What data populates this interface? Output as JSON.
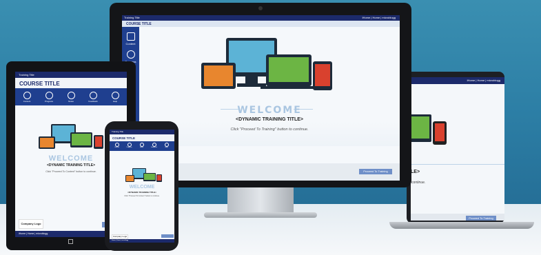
{
  "monitor": {
    "top_bar": {
      "title": "Training Title",
      "links": "iHome | Home  |  microblogg"
    },
    "course_title": "COURSE TITLE",
    "sidebar": [
      {
        "label": "Content",
        "icon": "book-icon"
      },
      {
        "label": "Progress",
        "icon": "check-icon"
      }
    ],
    "welcome": "WELCOME",
    "training_title": "<DYNAMIC TRAINING TITLE>",
    "instruction": "Click  \"Proceed To Training\" button to continue.",
    "proceed_button": "Proceed To Training"
  },
  "laptop": {
    "top_bar_links": "iHome | Home  |  microblogg",
    "partial_title": "LE>",
    "instruction_partial": "continue.",
    "proceed_button": "Proceed To Training"
  },
  "tablet": {
    "top_bar_title": "Training Title",
    "course_title": "COURSE TITLE",
    "nav": [
      {
        "label": "Content",
        "icon": "book-icon"
      },
      {
        "label": "Progress",
        "icon": "check-icon"
      },
      {
        "label": "Notes",
        "icon": "pencil-icon"
      },
      {
        "label": "Feedback",
        "icon": "chat-icon"
      },
      {
        "label": "Help",
        "icon": "help-icon"
      }
    ],
    "welcome": "WELCOME",
    "training_title": "<DYNAMIC TRAINING TITLE>",
    "instruction": "Click \"Proceed To Content\" button to continue.",
    "company_logo": "Company Logo",
    "footer_links": "iHome | Home  |  microblogg",
    "footer_right": "Powe"
  },
  "phone": {
    "top_bar_title": "Training Title",
    "course_title": "COURSE TITLE",
    "nav": [
      {
        "label": "Content",
        "icon": "book-icon"
      },
      {
        "label": "Progress",
        "icon": "check-icon"
      },
      {
        "label": "Notes",
        "icon": "pencil-icon"
      },
      {
        "label": "Feedback",
        "icon": "chat-icon"
      },
      {
        "label": "Help",
        "icon": "help-icon"
      }
    ],
    "welcome": "WELCOME",
    "training_title": "<DYNAMIC TRAINING TITLE>",
    "instruction": "Click \"Proceed To Content\" button to continue.",
    "company_logo": "Company Logo",
    "footer_links": "iHome | Home  |  microblogg"
  },
  "colors": {
    "accent": "#1f3f8f",
    "header": "#1c2a6b",
    "button": "#6f8fc8",
    "welcome": "#aac6e1"
  }
}
